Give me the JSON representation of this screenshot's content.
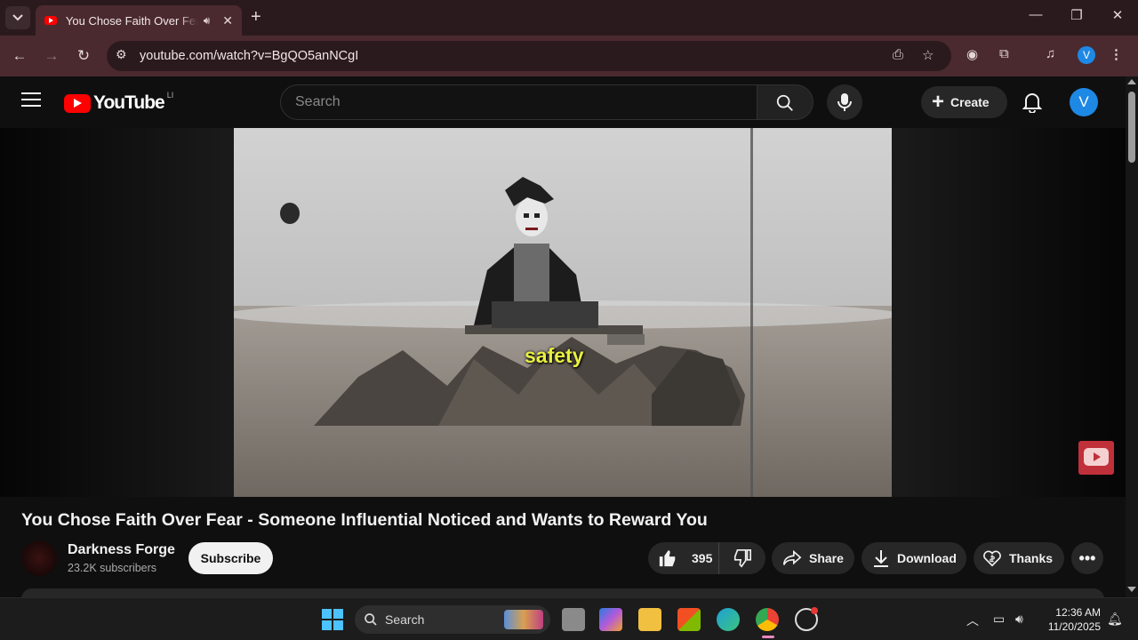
{
  "browser": {
    "tab_title": "You Chose Faith Over Fear - Someone Influential Noticed and Wants to Reward You",
    "url": "youtube.com/watch?v=BgQO5anNCgI",
    "profile_initial": "V"
  },
  "youtube": {
    "logo_text": "YouTube",
    "logo_region": "LI",
    "search_placeholder": "Search",
    "create_label": "Create",
    "avatar_initial": "V"
  },
  "video": {
    "caption": "safety",
    "title": "You Chose Faith Over Fear - Someone Influential Noticed and Wants to Reward You"
  },
  "channel": {
    "name": "Darkness Forge",
    "subscribers": "23.2K subscribers",
    "subscribe_label": "Subscribe"
  },
  "actions": {
    "like_count": "395",
    "share_label": "Share",
    "download_label": "Download",
    "thanks_label": "Thanks"
  },
  "taskbar": {
    "search_label": "Search",
    "time": "12:36 AM",
    "date": "11/20/2025"
  },
  "colors": {
    "browser_frame": "#4a2a2f",
    "tabstrip": "#2b1a1d",
    "youtube_red": "#ff0000",
    "caption_yellow": "#e8f040",
    "avatar_blue": "#1e88e5"
  }
}
